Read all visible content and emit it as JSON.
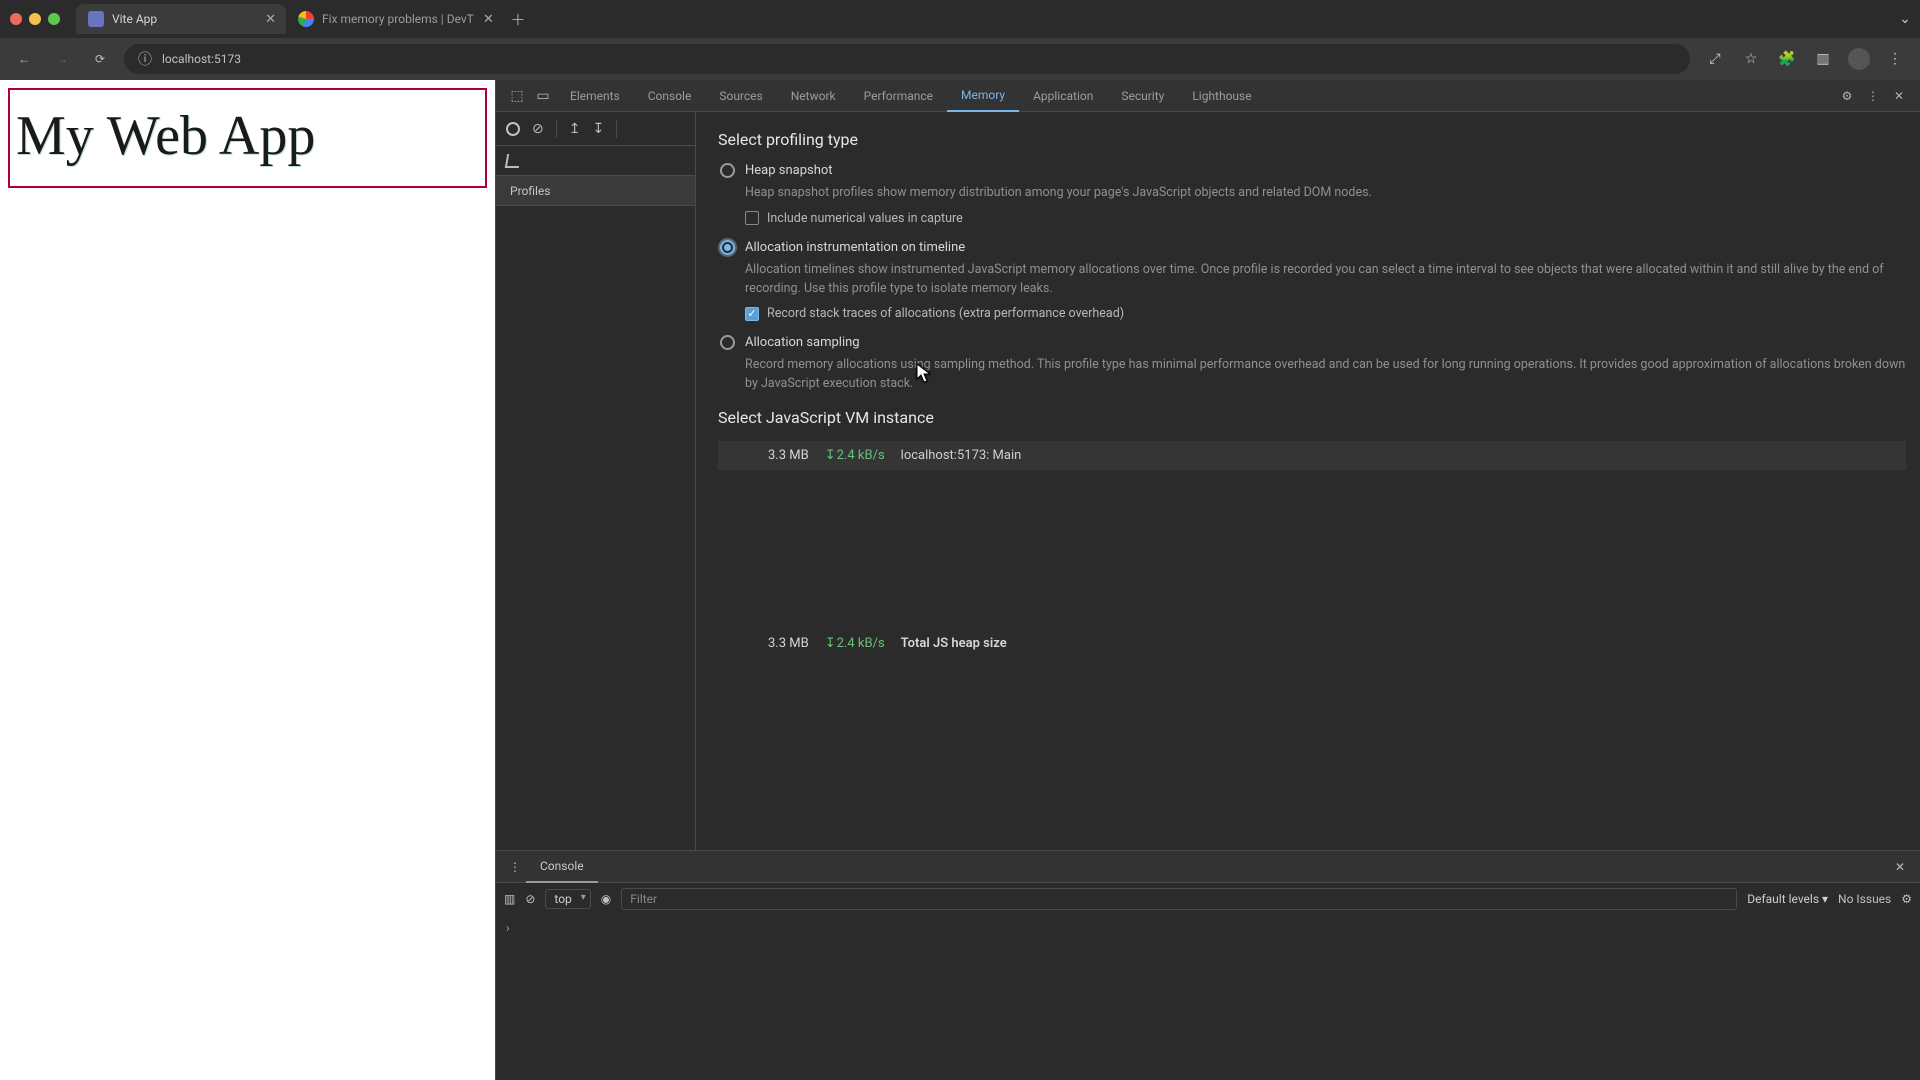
{
  "browser": {
    "tabs": [
      {
        "title": "Vite App",
        "active": true
      },
      {
        "title": "Fix memory problems  |  DevT"
      }
    ],
    "url": "localhost:5173"
  },
  "page": {
    "heading": "My Web App"
  },
  "devtools": {
    "tabs": [
      "Elements",
      "Console",
      "Sources",
      "Network",
      "Performance",
      "Memory",
      "Application",
      "Security",
      "Lighthouse"
    ],
    "active_tab": "Memory",
    "profiles_header": "Profiles",
    "profiling_title": "Select profiling type",
    "heap": {
      "label": "Heap snapshot",
      "desc": "Heap snapshot profiles show memory distribution among your page's JavaScript objects and related DOM nodes.",
      "numerical_label": "Include numerical values in capture"
    },
    "timeline": {
      "label": "Allocation instrumentation on timeline",
      "desc": "Allocation timelines show instrumented JavaScript memory allocations over time. Once profile is recorded you can select a time interval to see objects that were allocated within it and still alive by the end of recording. Use this profile type to isolate memory leaks.",
      "stacks_label": "Record stack traces of allocations (extra performance overhead)"
    },
    "sampling": {
      "label": "Allocation sampling",
      "desc": "Record memory allocations using sampling method. This profile type has minimal performance overhead and can be used for long running operations. It provides good approximation of allocations broken down by JavaScript execution stack."
    },
    "vm_title": "Select JavaScript VM instance",
    "vm_instance": {
      "size": "3.3 MB",
      "rate": "2.4 kB/s",
      "name": "localhost:5173: Main"
    },
    "vm_total": {
      "size": "3.3 MB",
      "rate": "2.4 kB/s",
      "label": "Total JS heap size"
    }
  },
  "drawer": {
    "tab": "Console",
    "context": "top",
    "filter_placeholder": "Filter",
    "levels": "Default levels",
    "issues": "No Issues"
  }
}
